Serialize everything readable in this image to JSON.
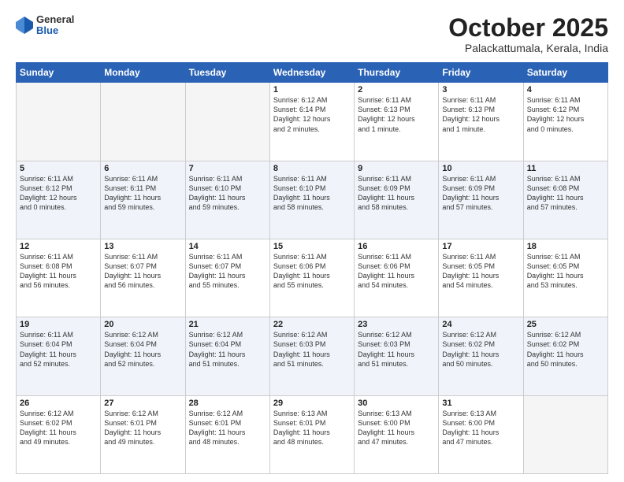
{
  "header": {
    "logo_general": "General",
    "logo_blue": "Blue",
    "month": "October 2025",
    "location": "Palackattumala, Kerala, India"
  },
  "weekdays": [
    "Sunday",
    "Monday",
    "Tuesday",
    "Wednesday",
    "Thursday",
    "Friday",
    "Saturday"
  ],
  "weeks": [
    [
      {
        "day": "",
        "info": ""
      },
      {
        "day": "",
        "info": ""
      },
      {
        "day": "",
        "info": ""
      },
      {
        "day": "1",
        "info": "Sunrise: 6:12 AM\nSunset: 6:14 PM\nDaylight: 12 hours\nand 2 minutes."
      },
      {
        "day": "2",
        "info": "Sunrise: 6:11 AM\nSunset: 6:13 PM\nDaylight: 12 hours\nand 1 minute."
      },
      {
        "day": "3",
        "info": "Sunrise: 6:11 AM\nSunset: 6:13 PM\nDaylight: 12 hours\nand 1 minute."
      },
      {
        "day": "4",
        "info": "Sunrise: 6:11 AM\nSunset: 6:12 PM\nDaylight: 12 hours\nand 0 minutes."
      }
    ],
    [
      {
        "day": "5",
        "info": "Sunrise: 6:11 AM\nSunset: 6:12 PM\nDaylight: 12 hours\nand 0 minutes."
      },
      {
        "day": "6",
        "info": "Sunrise: 6:11 AM\nSunset: 6:11 PM\nDaylight: 11 hours\nand 59 minutes."
      },
      {
        "day": "7",
        "info": "Sunrise: 6:11 AM\nSunset: 6:10 PM\nDaylight: 11 hours\nand 59 minutes."
      },
      {
        "day": "8",
        "info": "Sunrise: 6:11 AM\nSunset: 6:10 PM\nDaylight: 11 hours\nand 58 minutes."
      },
      {
        "day": "9",
        "info": "Sunrise: 6:11 AM\nSunset: 6:09 PM\nDaylight: 11 hours\nand 58 minutes."
      },
      {
        "day": "10",
        "info": "Sunrise: 6:11 AM\nSunset: 6:09 PM\nDaylight: 11 hours\nand 57 minutes."
      },
      {
        "day": "11",
        "info": "Sunrise: 6:11 AM\nSunset: 6:08 PM\nDaylight: 11 hours\nand 57 minutes."
      }
    ],
    [
      {
        "day": "12",
        "info": "Sunrise: 6:11 AM\nSunset: 6:08 PM\nDaylight: 11 hours\nand 56 minutes."
      },
      {
        "day": "13",
        "info": "Sunrise: 6:11 AM\nSunset: 6:07 PM\nDaylight: 11 hours\nand 56 minutes."
      },
      {
        "day": "14",
        "info": "Sunrise: 6:11 AM\nSunset: 6:07 PM\nDaylight: 11 hours\nand 55 minutes."
      },
      {
        "day": "15",
        "info": "Sunrise: 6:11 AM\nSunset: 6:06 PM\nDaylight: 11 hours\nand 55 minutes."
      },
      {
        "day": "16",
        "info": "Sunrise: 6:11 AM\nSunset: 6:06 PM\nDaylight: 11 hours\nand 54 minutes."
      },
      {
        "day": "17",
        "info": "Sunrise: 6:11 AM\nSunset: 6:05 PM\nDaylight: 11 hours\nand 54 minutes."
      },
      {
        "day": "18",
        "info": "Sunrise: 6:11 AM\nSunset: 6:05 PM\nDaylight: 11 hours\nand 53 minutes."
      }
    ],
    [
      {
        "day": "19",
        "info": "Sunrise: 6:11 AM\nSunset: 6:04 PM\nDaylight: 11 hours\nand 52 minutes."
      },
      {
        "day": "20",
        "info": "Sunrise: 6:12 AM\nSunset: 6:04 PM\nDaylight: 11 hours\nand 52 minutes."
      },
      {
        "day": "21",
        "info": "Sunrise: 6:12 AM\nSunset: 6:04 PM\nDaylight: 11 hours\nand 51 minutes."
      },
      {
        "day": "22",
        "info": "Sunrise: 6:12 AM\nSunset: 6:03 PM\nDaylight: 11 hours\nand 51 minutes."
      },
      {
        "day": "23",
        "info": "Sunrise: 6:12 AM\nSunset: 6:03 PM\nDaylight: 11 hours\nand 51 minutes."
      },
      {
        "day": "24",
        "info": "Sunrise: 6:12 AM\nSunset: 6:02 PM\nDaylight: 11 hours\nand 50 minutes."
      },
      {
        "day": "25",
        "info": "Sunrise: 6:12 AM\nSunset: 6:02 PM\nDaylight: 11 hours\nand 50 minutes."
      }
    ],
    [
      {
        "day": "26",
        "info": "Sunrise: 6:12 AM\nSunset: 6:02 PM\nDaylight: 11 hours\nand 49 minutes."
      },
      {
        "day": "27",
        "info": "Sunrise: 6:12 AM\nSunset: 6:01 PM\nDaylight: 11 hours\nand 49 minutes."
      },
      {
        "day": "28",
        "info": "Sunrise: 6:12 AM\nSunset: 6:01 PM\nDaylight: 11 hours\nand 48 minutes."
      },
      {
        "day": "29",
        "info": "Sunrise: 6:13 AM\nSunset: 6:01 PM\nDaylight: 11 hours\nand 48 minutes."
      },
      {
        "day": "30",
        "info": "Sunrise: 6:13 AM\nSunset: 6:00 PM\nDaylight: 11 hours\nand 47 minutes."
      },
      {
        "day": "31",
        "info": "Sunrise: 6:13 AM\nSunset: 6:00 PM\nDaylight: 11 hours\nand 47 minutes."
      },
      {
        "day": "",
        "info": ""
      }
    ]
  ]
}
